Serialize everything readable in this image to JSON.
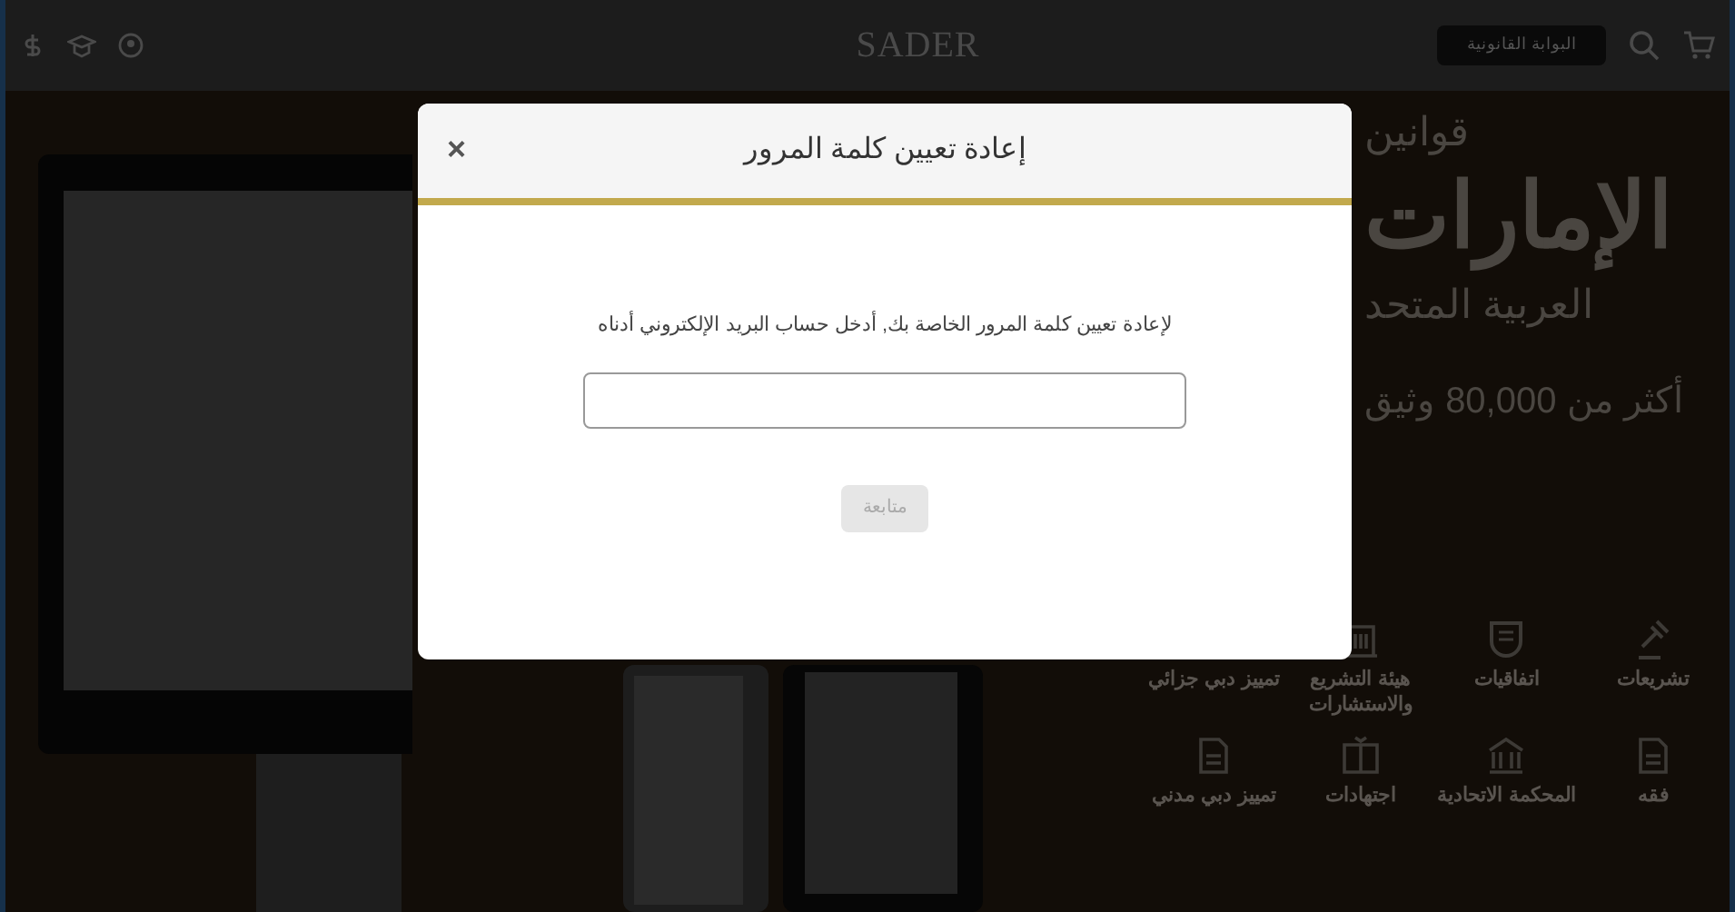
{
  "header": {
    "logo": "SADER",
    "portal_button": "البوابة القانونية"
  },
  "hero": {
    "kicker": "قوانين",
    "title": "الإمارات",
    "subtitle": "العربية المتحد",
    "count_line": "أكثر من 80,000 وثيق"
  },
  "categories": [
    {
      "label": "تشريعات",
      "kind": "gavel"
    },
    {
      "label": "اتفاقيات",
      "kind": "shield"
    },
    {
      "label": "هيئة التشريع والاستشارات",
      "kind": "building"
    },
    {
      "label": "تمييز دبي جزائي",
      "kind": "none"
    },
    {
      "label": "فقه",
      "kind": "document"
    },
    {
      "label": "المحكمة الاتحادية",
      "kind": "court"
    },
    {
      "label": "اجتهادات",
      "kind": "book"
    },
    {
      "label": "تمييز دبي مدني",
      "kind": "document"
    }
  ],
  "modal": {
    "title": "إعادة تعيين كلمة المرور",
    "close": "×",
    "instruction": "لإعادة تعيين كلمة المرور الخاصة بك, أدخل حساب البريد الإلكتروني أدناه",
    "submit": {
      "label": "متابعة",
      "disabled": true
    }
  }
}
